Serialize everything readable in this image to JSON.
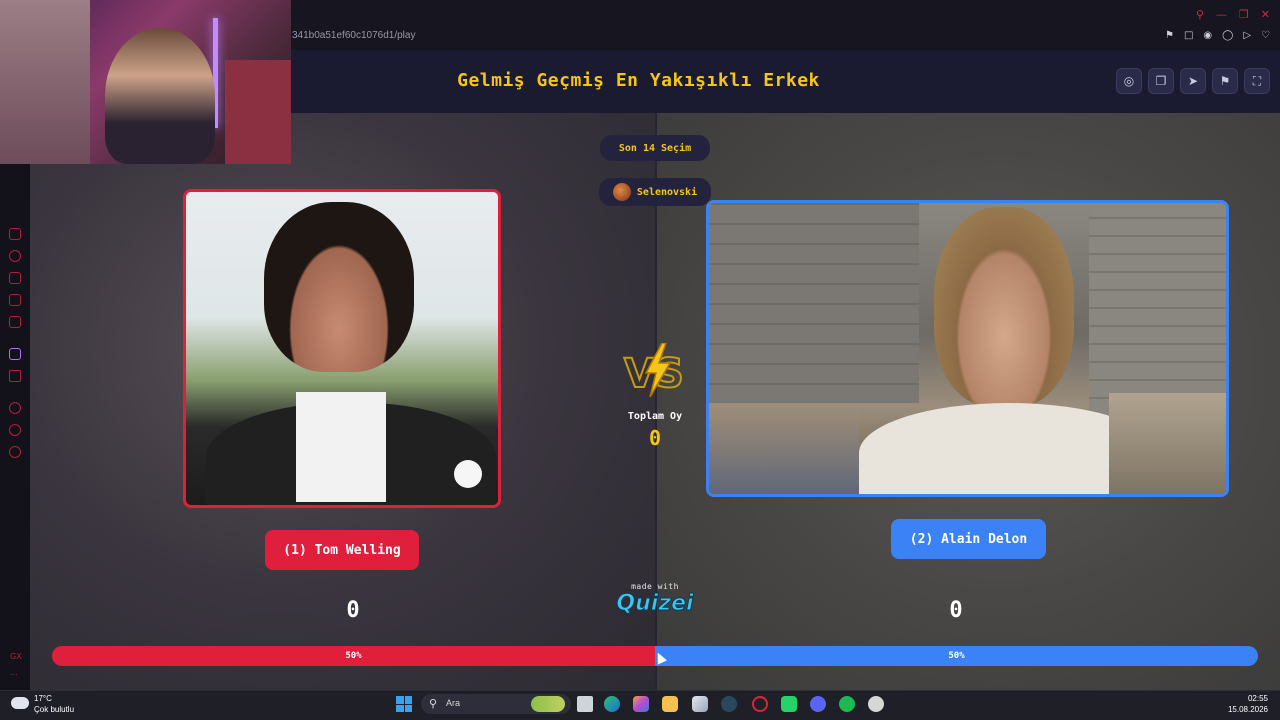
{
  "browser": {
    "url": "341b0a51ef60c1076d1/play",
    "sidebar_text": "GX",
    "sidebar_more": "..."
  },
  "quiz": {
    "title": "Gelmiş Geçmiş En Yakışıklı Erkek",
    "last_choices": "Son 14 Seçim",
    "user": "Selenovski",
    "vs_label": "VS",
    "total_label": "Toplam Oy",
    "total_value": "0",
    "made_with": "made with",
    "brand": "Quizei",
    "left": {
      "name": "(1) Tom Welling",
      "count": "0",
      "percent": "50%",
      "color": "#e01f3d"
    },
    "right": {
      "name": "(2) Alain Delon",
      "count": "0",
      "percent": "50%",
      "color": "#3b82f6"
    },
    "vote_share": {
      "left": 0.5,
      "right": 0.5
    }
  },
  "taskbar": {
    "temperature": "17°C",
    "weather": "Çok bulutlu",
    "search_placeholder": "Ara",
    "time": "02:55",
    "date": "15.08.2026"
  }
}
